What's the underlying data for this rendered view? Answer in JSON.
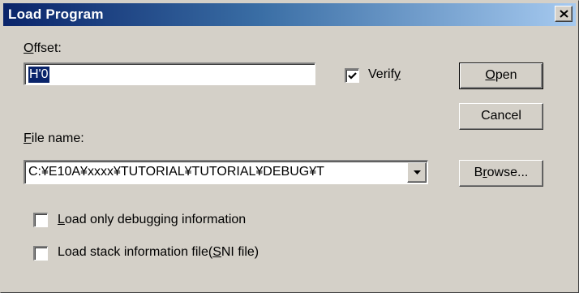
{
  "window": {
    "title": "Load Program",
    "close_icon": "close-icon"
  },
  "offset": {
    "label_accel": "O",
    "label_rest": "ffset:",
    "value": "H'0"
  },
  "verify": {
    "label_pre": "Verif",
    "label_accel": "y",
    "checked": true
  },
  "file_name": {
    "label_accel": "F",
    "label_rest": "ile name:",
    "value": "C:¥E10A¥xxxx¥TUTORIAL¥TUTORIAL¥DEBUG¥T"
  },
  "options": {
    "debug_only": {
      "accel": "L",
      "rest": "oad only debugging information",
      "checked": false
    },
    "stack_info": {
      "pre": "Load stack information file(",
      "accel": "S",
      "post": "NI file)",
      "checked": false
    }
  },
  "buttons": {
    "open": {
      "accel": "O",
      "rest": "pen"
    },
    "cancel": {
      "label": "Cancel"
    },
    "browse": {
      "pre": "B",
      "accel": "r",
      "post": "owse..."
    }
  },
  "colors": {
    "dialog_bg": "#d4d0c8",
    "title_start": "#0a246a",
    "title_end": "#a6caf0",
    "selection": "#0a246a"
  }
}
